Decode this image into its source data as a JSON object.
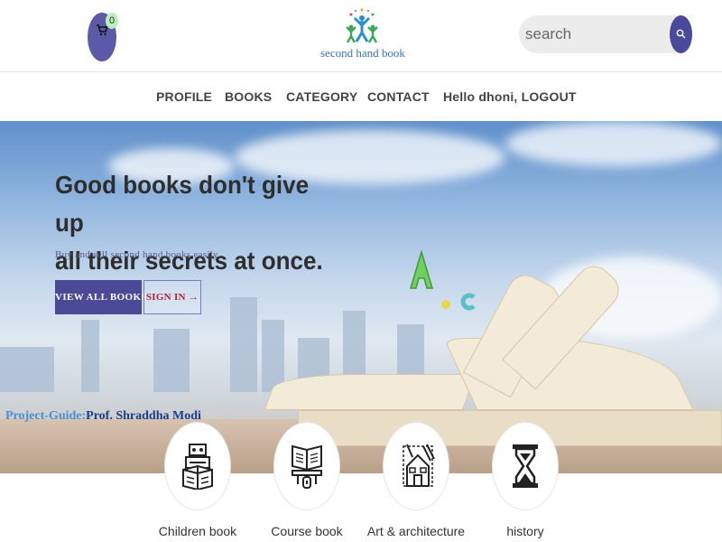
{
  "header": {
    "cart_count": "0",
    "logo_text": "second hand book",
    "search_placeholder": "search"
  },
  "nav": {
    "items": [
      "PROFILE",
      "BOOKS",
      "CATEGORY",
      "CONTACT",
      "Hello dhoni, LOGOUT"
    ]
  },
  "hero": {
    "title_line1": "Good books don't give up",
    "title_line2": "all their secrets at once.",
    "subtitle": "Buy and sell second hand books easily.",
    "view_all_label": "VIEW ALL BOOKS",
    "sign_in_label": "SIGN IN →",
    "guide_label": "Project-Guide:",
    "guide_name": "Prof. Shraddha Modi"
  },
  "categories": [
    {
      "label": "Children book",
      "icon": "robot-box-icon"
    },
    {
      "label": "Course book",
      "icon": "book-on-stand-icon"
    },
    {
      "label": "Art & architecture",
      "icon": "house-drawing-icon"
    },
    {
      "label": "history",
      "icon": "hourglass-icon"
    }
  ],
  "colors": {
    "accent": "#4a4a96",
    "signin_text": "#b0203a",
    "logo_text": "#3b6fb3"
  }
}
